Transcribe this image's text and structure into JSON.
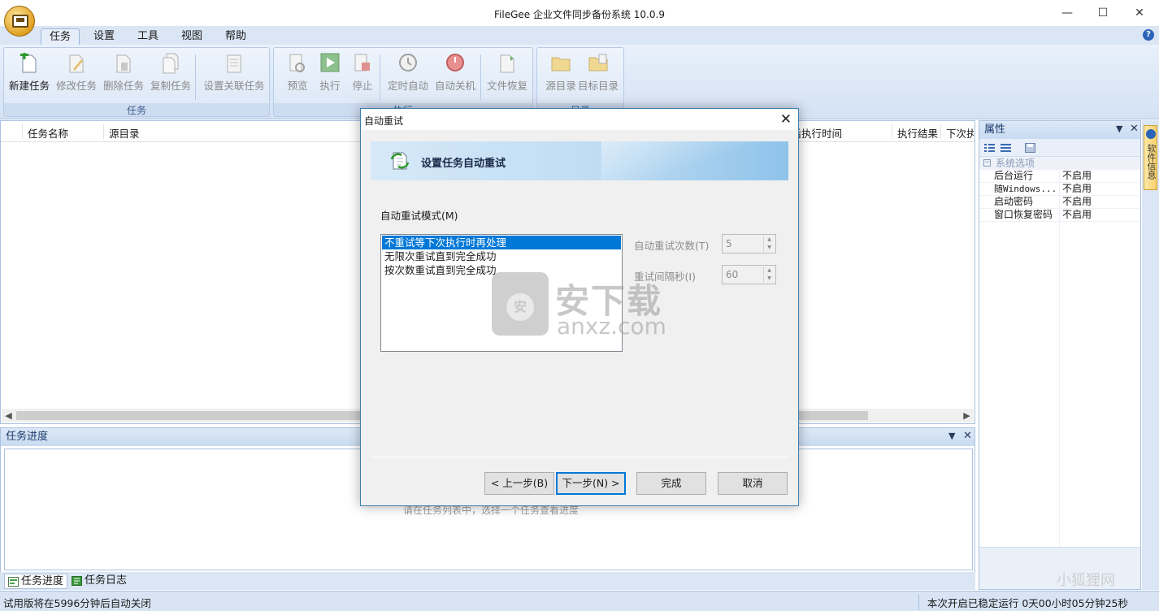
{
  "window": {
    "title": "FileGee 企业文件同步备份系统 10.0.9",
    "minimize": "—",
    "maximize": "☐",
    "close": "✕"
  },
  "ribbon_tabs": [
    "任务",
    "设置",
    "工具",
    "视图",
    "帮助"
  ],
  "help_glyph": "?",
  "ribbon_groups": {
    "task": {
      "label": "任务",
      "buttons": [
        "新建任务",
        "修改任务",
        "删除任务",
        "复制任务",
        "设置关联任务"
      ]
    },
    "execute": {
      "label": "执行",
      "buttons": [
        "预览",
        "执行",
        "停止",
        "定时自动",
        "自动关机",
        "文件恢复"
      ]
    },
    "directory": {
      "label": "目录",
      "buttons": [
        "源目录",
        "目标目录"
      ]
    }
  },
  "task_list": {
    "columns": [
      "任务名称",
      "源目录",
      "最后执行时间",
      "执行结果",
      "下次执"
    ]
  },
  "progress_panel": {
    "title": "任务进度",
    "hint": "请在任务列表中，选择一个任务查看进度"
  },
  "bottom_tabs": [
    "任务进度",
    "任务日志"
  ],
  "properties": {
    "title": "属性",
    "category": "系统选项",
    "rows": [
      {
        "key": "后台运行",
        "value": "不启用"
      },
      {
        "key": "随Windows...",
        "value": "不启用"
      },
      {
        "key": "启动密码",
        "value": "不启用"
      },
      {
        "key": "窗口恢复密码",
        "value": "不启用"
      }
    ]
  },
  "side_tab": "软件信息",
  "status": {
    "left": "试用版将在5996分钟后自动关闭",
    "right": "本次开启已稳定运行 0天00小时05分钟25秒"
  },
  "dialog": {
    "title": "自动重试",
    "close": "✕",
    "banner": "设置任务自动重试",
    "mode_label": "自动重试模式(M)",
    "modes": [
      "不重试等下次执行时再处理",
      "无限次重试直到完全成功",
      "按次数重试直到完全成功"
    ],
    "selected_mode": 0,
    "retry_count_label": "自动重试次数(T)",
    "retry_count": "5",
    "retry_interval_label": "重试间隔秒(I)",
    "retry_interval": "60",
    "buttons": {
      "prev": "< 上一步(B)",
      "next": "下一步(N) >",
      "finish": "完成",
      "cancel": "取消"
    }
  },
  "watermark": {
    "logo_glyph": "安",
    "cn": "安下载",
    "en": "anxz.com",
    "corner": "小狐狸网"
  },
  "colors": {
    "accent": "#0078d7",
    "ribbon": "#dbe6f4",
    "dialog_border": "#3c7fb1"
  }
}
